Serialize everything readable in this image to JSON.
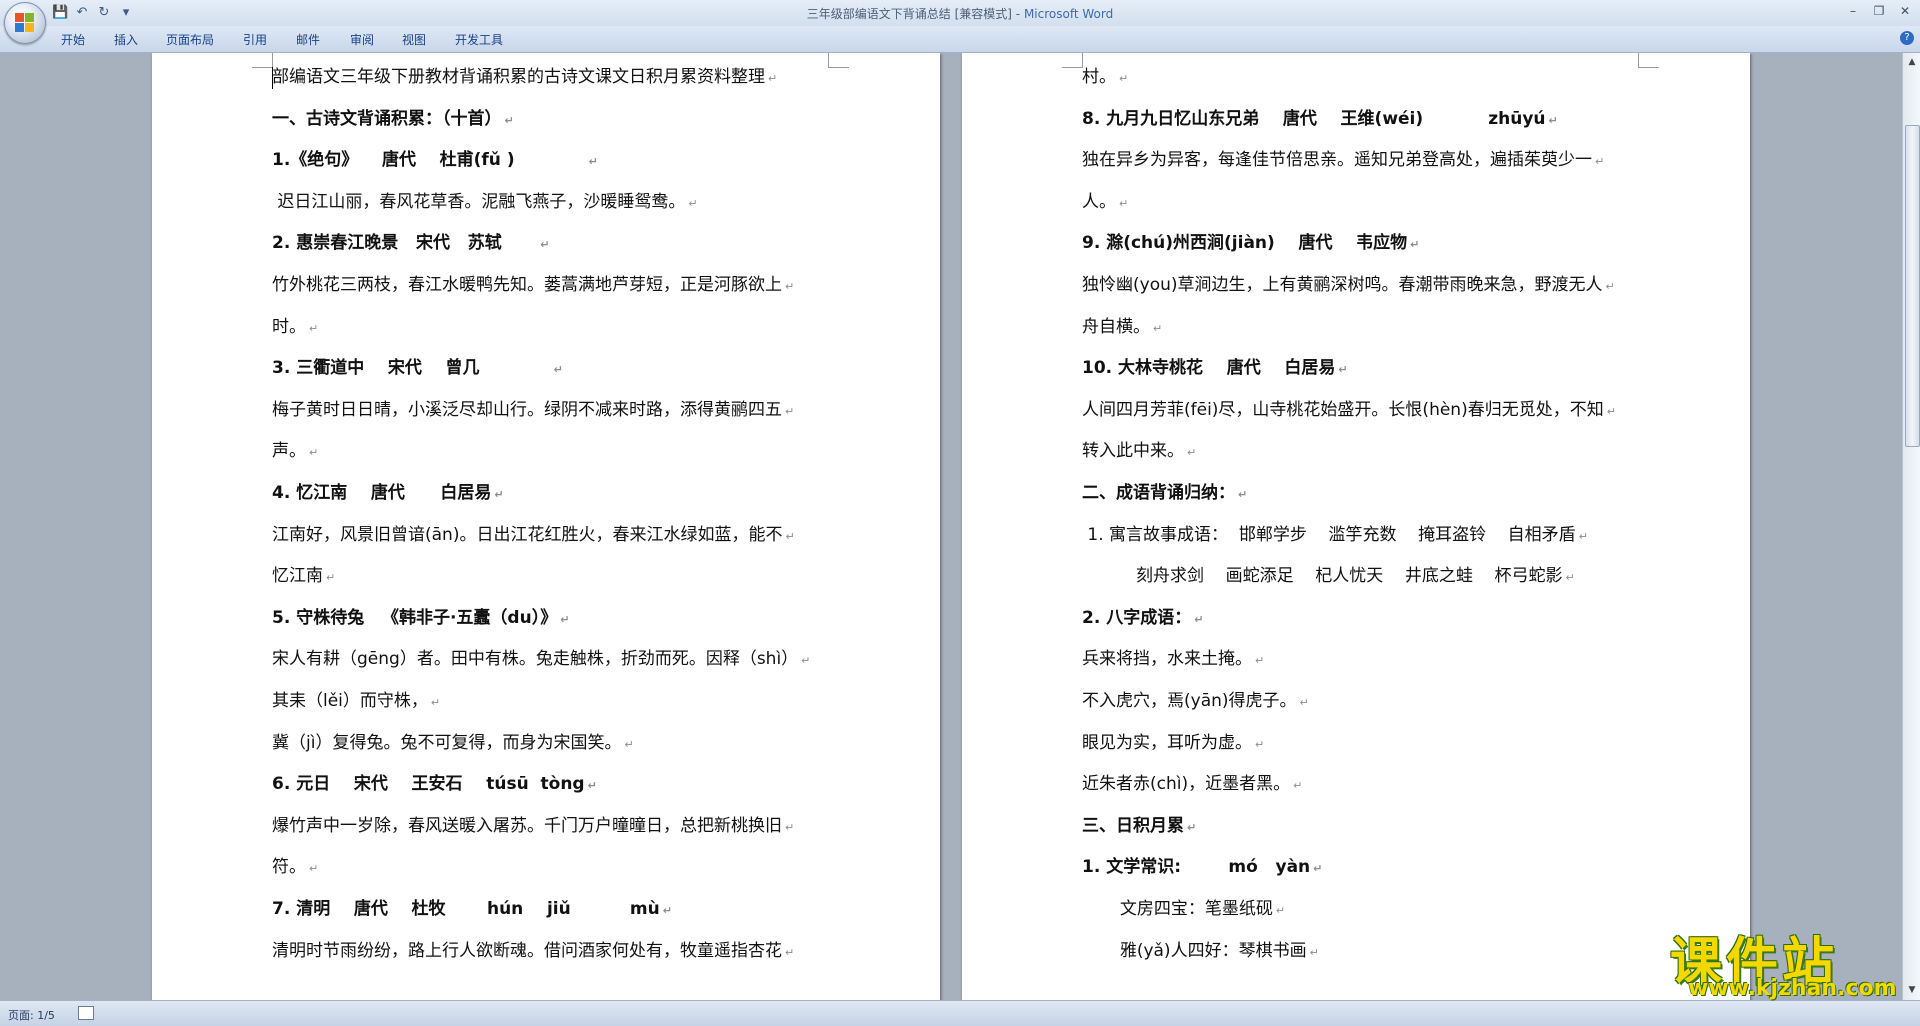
{
  "window": {
    "title": "三年级部编语文下背诵总结 [兼容模式]",
    "separator": " - ",
    "app_name": "Microsoft Word",
    "controls": [
      "–",
      "❐",
      "✕"
    ]
  },
  "qat": {
    "save_icon": "💾",
    "undo_icon": "↶",
    "redo_icon": "↻",
    "more_icon": "▾"
  },
  "ribbon": {
    "tabs": [
      "开始",
      "插入",
      "页面布局",
      "引用",
      "邮件",
      "审阅",
      "视图",
      "开发工具"
    ],
    "help_label": "?"
  },
  "left_page": {
    "lines": [
      {
        "text": "部编语文三年级下册教材背诵积累的古诗文课文日积月累资料整理",
        "bold": false
      },
      {
        "text": "一、古诗文背诵积累：（十首）",
        "bold": true
      },
      {
        "text": "1.《绝句》    唐代    杜甫(fǔ )            ",
        "bold": true
      },
      {
        "text": " 迟日江山丽，春风花草香。泥融飞燕子，沙暖睡鸳鸯。",
        "bold": false
      },
      {
        "text": "2. 惠崇春江晚景   宋代   苏轼      ",
        "bold": true
      },
      {
        "text": "竹外桃花三两枝，春江水暖鸭先知。蒌蒿满地芦芽短，正是河豚欲上",
        "bold": false
      },
      {
        "text": "时。",
        "bold": false
      },
      {
        "text": "3. 三衢道中    宋代    曾几            ",
        "bold": true
      },
      {
        "text": "梅子黄时日日晴，小溪泛尽却山行。绿阴不减来时路，添得黄鹂四五",
        "bold": false
      },
      {
        "text": "声。",
        "bold": false
      },
      {
        "text": "4. 忆江南    唐代      白居易",
        "bold": true
      },
      {
        "text": "江南好，风景旧曾谙(ān)。日出江花红胜火，春来江水绿如蓝，能不",
        "bold": false
      },
      {
        "text": "忆江南",
        "bold": false
      },
      {
        "text": "5. 守株待兔   《韩非子·五蠹（du）》",
        "bold": true
      },
      {
        "text": "宋人有耕（gēng）者。田中有株。兔走触株，折劲而死。因释（shì）",
        "bold": false
      },
      {
        "text": "其耒（lěi）而守株，",
        "bold": false
      },
      {
        "text": "冀（jì）复得兔。兔不可复得，而身为宋国笑。",
        "bold": false
      },
      {
        "text": "6. 元日    宋代    王安石    túsū  tòng",
        "bold": true
      },
      {
        "text": "爆竹声中一岁除，春风送暖入屠苏。千门万户曈曈日，总把新桃换旧",
        "bold": false
      },
      {
        "text": "符。",
        "bold": false
      },
      {
        "text": "7. 清明    唐代    杜牧       hún    jiǔ          mù",
        "bold": true
      },
      {
        "text": "清明时节雨纷纷，路上行人欲断魂。借问酒家何处有，牧童遥指杏花",
        "bold": false
      }
    ]
  },
  "right_page": {
    "lines": [
      {
        "text": "村。",
        "bold": false
      },
      {
        "text": "8. 九月九日忆山东兄弟    唐代    王维(wéi)           zhūyú",
        "bold": true
      },
      {
        "text": "独在异乡为异客，每逢佳节倍思亲。遥知兄弟登高处，遍插茱萸少一",
        "bold": false
      },
      {
        "text": "人。",
        "bold": false
      },
      {
        "text": "9. 滁(chú)州西涧(jiàn)    唐代    韦应物",
        "bold": true
      },
      {
        "text": "独怜幽(you)草涧边生，上有黄鹂深树鸣。春潮带雨晚来急，野渡无人",
        "bold": false
      },
      {
        "text": "舟自横。",
        "bold": false
      },
      {
        "text": "10. 大林寺桃花    唐代    白居易",
        "bold": true
      },
      {
        "text": "人间四月芳菲(fēi)尽，山寺桃花始盛开。长恨(hèn)春归无觅处，不知",
        "bold": false
      },
      {
        "text": "转入此中来。",
        "bold": false
      },
      {
        "text": "二、成语背诵归纳：",
        "bold": true
      },
      {
        "text": " 1. 寓言故事成语：  邯郸学步    滥竽充数    掩耳盗铃    自相矛盾",
        "bold": false
      },
      {
        "text": "          刻舟求剑    画蛇添足    杞人忧天    井底之蛙    杯弓蛇影",
        "bold": false
      },
      {
        "text": "2. 八字成语：",
        "bold": true
      },
      {
        "text": "兵来将挡，水来土掩。",
        "bold": false
      },
      {
        "text": "不入虎穴，焉(yān)得虎子。",
        "bold": false
      },
      {
        "text": "眼见为实，耳听为虚。",
        "bold": false
      },
      {
        "text": "近朱者赤(chì)，近墨者黑。",
        "bold": false
      },
      {
        "text": "三、日积月累",
        "bold": true
      },
      {
        "text": "1. 文学常识:        mó   yàn",
        "bold": true
      },
      {
        "text": "       文房四宝：笔墨纸砚",
        "bold": false
      },
      {
        "text": "       雅(yǎ)人四好：琴棋书画",
        "bold": false
      }
    ]
  },
  "status": {
    "page_label": "页面: 1/5"
  },
  "watermark": {
    "name": "课件站",
    "url": "www.kjzhan.com"
  }
}
